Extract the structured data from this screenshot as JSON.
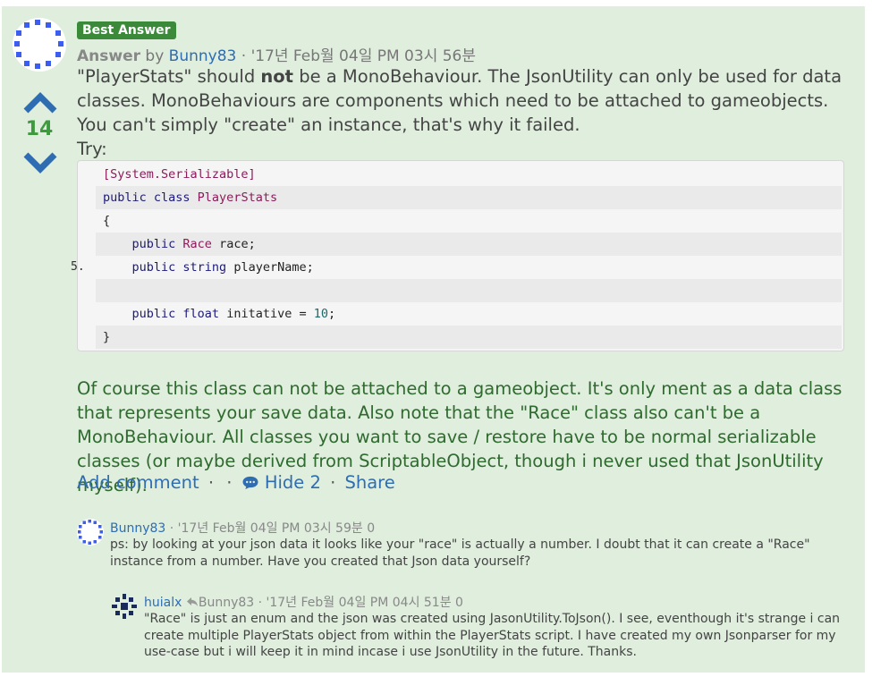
{
  "answer": {
    "badge": "Best Answer",
    "label": "Answer",
    "by": " by ",
    "author": "Bunny83",
    "timestamp": " · '17년 Feb월 04일 PM 03시 56분",
    "votes": "14",
    "p1_a": "\"PlayerStats\" should ",
    "p1_bold": "not",
    "p1_b": " be a MonoBehaviour. The JsonUtility can only be used for data classes. MonoBehaviours are components which need to be attached to gameobjects. You can't simply \"create\" an instance, that's why it failed.",
    "try": "Try:",
    "p2": "Of course this class can not be attached to a gameobject. It's only ment as a data class that represents your save data. Also note that the \"Race\" class also can't be a MonoBehaviour. All classes you want to save / restore have to be normal serializable classes (or maybe derived from ScriptableObject, though i never used that JsonUtility myself).",
    "add_comment": "Add comment",
    "sep1": "·",
    "sep2": "·",
    "hide": "Hide 2",
    "sep3": "·",
    "share": "Share"
  },
  "code": {
    "line_number": "5.",
    "lines": [
      "[System.Serializable]",
      "public class PlayerStats",
      "{",
      "    public Race race;",
      "    public string playerName;",
      "",
      "    public float initative = 10;",
      "}"
    ]
  },
  "comments": [
    {
      "author": "Bunny83",
      "timestamp": " · '17년 Feb월 04일 PM 03시 59분",
      "score": "0",
      "text": "ps: by looking at your json data it looks like your \"race\" is actually a number. I doubt that it can create a \"Race\" instance from a number. Have you created that Json data yourself?"
    },
    {
      "author": "huialx",
      "reply_to": "Bunny83",
      "timestamp": " · '17년 Feb월 04일 PM 04시 51분",
      "score": "0",
      "text": "\"Race\" is just an enum and the json was created using JasonUtility.ToJson(). I see, eventhough it's strange i can create multiple PlayerStats object from within the PlayerStats script. I have created my own Jsonparser for my use-case but i will keep it in mind incase i use JsonUtility in the future. Thanks."
    }
  ],
  "colors": {
    "accent_green": "#3e9a3e",
    "link_blue": "#2f6db2",
    "background": "#dfeedd"
  }
}
